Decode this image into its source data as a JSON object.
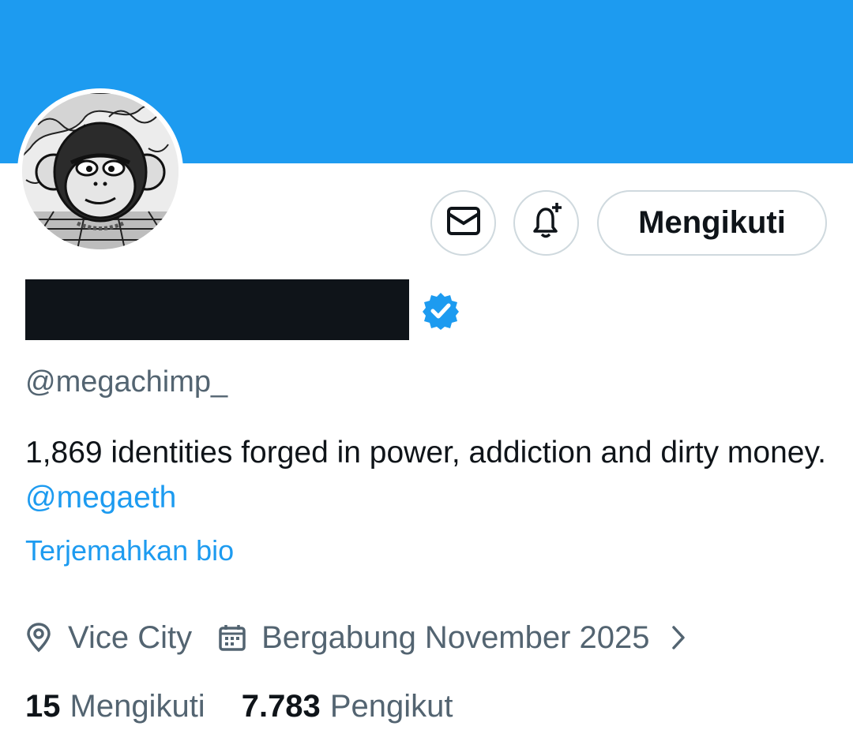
{
  "profile": {
    "handle": "@megachimp_",
    "bio_text": "1,869 identities forged in power, addiction and dirty money. ",
    "bio_mention": "@megaeth",
    "translate_label": "Terjemahkan bio",
    "location": "Vice City",
    "joined": "Bergabung November 2025"
  },
  "actions": {
    "follow_label": "Mengikuti"
  },
  "stats": {
    "following_count": "15",
    "following_label": "Mengikuti",
    "followers_count": "7.783",
    "followers_label": "Pengikut"
  },
  "colors": {
    "banner": "#1d9bf0",
    "accent": "#1d9bf0",
    "secondary_text": "#536471",
    "primary_text": "#0f1419",
    "border": "#cfd9de"
  },
  "icons": [
    "mail-icon",
    "bell-plus-icon",
    "verified-badge-icon",
    "location-pin-icon",
    "calendar-icon",
    "chevron-right-icon"
  ]
}
